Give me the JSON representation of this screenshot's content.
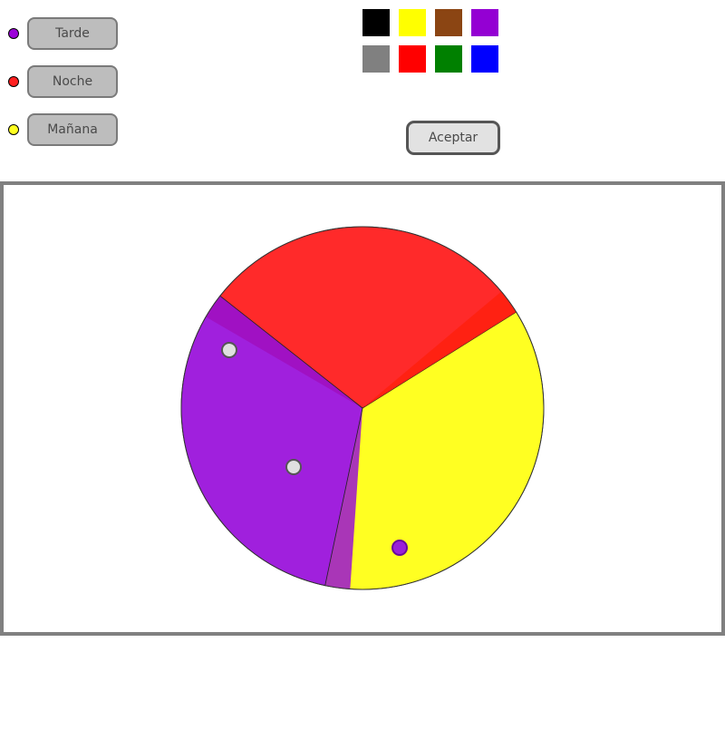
{
  "categories": [
    {
      "id": "tarde",
      "label": "Tarde",
      "color": "#9b00d8"
    },
    {
      "id": "noche",
      "label": "Noche",
      "color": "#ff2020"
    },
    {
      "id": "manana",
      "label": "Mañana",
      "color": "#ffff20"
    }
  ],
  "palette": [
    {
      "name": "black",
      "color": "#000000"
    },
    {
      "name": "yellow",
      "color": "#ffff00"
    },
    {
      "name": "brown",
      "color": "#8b4513"
    },
    {
      "name": "purple",
      "color": "#9400d3"
    },
    {
      "name": "gray",
      "color": "#808080"
    },
    {
      "name": "red",
      "color": "#ff0000"
    },
    {
      "name": "green",
      "color": "#008000"
    },
    {
      "name": "blue",
      "color": "#0000ff"
    }
  ],
  "accept_label": "Aceptar",
  "chart_data": {
    "type": "pie",
    "slices": [
      {
        "name": "Mañana",
        "value": 37.2,
        "color": "#ffff22",
        "handle": "white"
      },
      {
        "name": "Tarde",
        "value": 32.3,
        "color": "#a020dd",
        "handle": "purple"
      },
      {
        "name": "Noche",
        "value": 30.5,
        "color": "#ff2a2a",
        "handle": "white"
      }
    ]
  }
}
